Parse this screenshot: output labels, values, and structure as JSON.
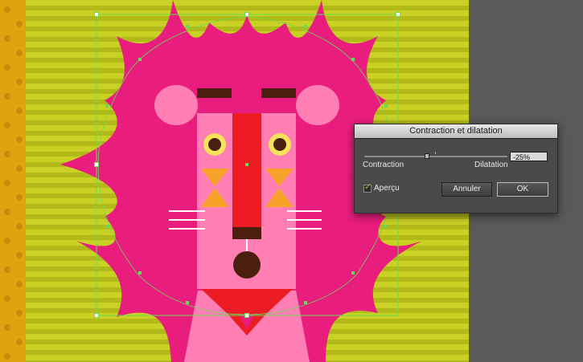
{
  "dialog": {
    "title": "Contraction et dilatation",
    "left_label": "Contraction",
    "right_label": "Dilatation",
    "value": "-25%",
    "slider_value_percent": -25,
    "slider_range_percent": [
      -200,
      200
    ],
    "preview_label": "Aperçu",
    "preview_checked": true,
    "cancel_label": "Annuler",
    "ok_label": "OK"
  },
  "artwork": {
    "subject": "lion illustration with Pucker & Bloat effect",
    "colors": {
      "background_stripe_light": "#c9d124",
      "background_stripe_dark": "#b2ba1a",
      "left_strip": "#e0a20f",
      "mane": "#e81d7d",
      "face": "#ff7fb4",
      "nose": "#ed1c24",
      "brown": "#4a1f0f",
      "eye_ring": "#f5e35a",
      "triangle": "#f7a32a",
      "pasteboard": "#5a5a5a",
      "selection": "#66dd55"
    }
  }
}
